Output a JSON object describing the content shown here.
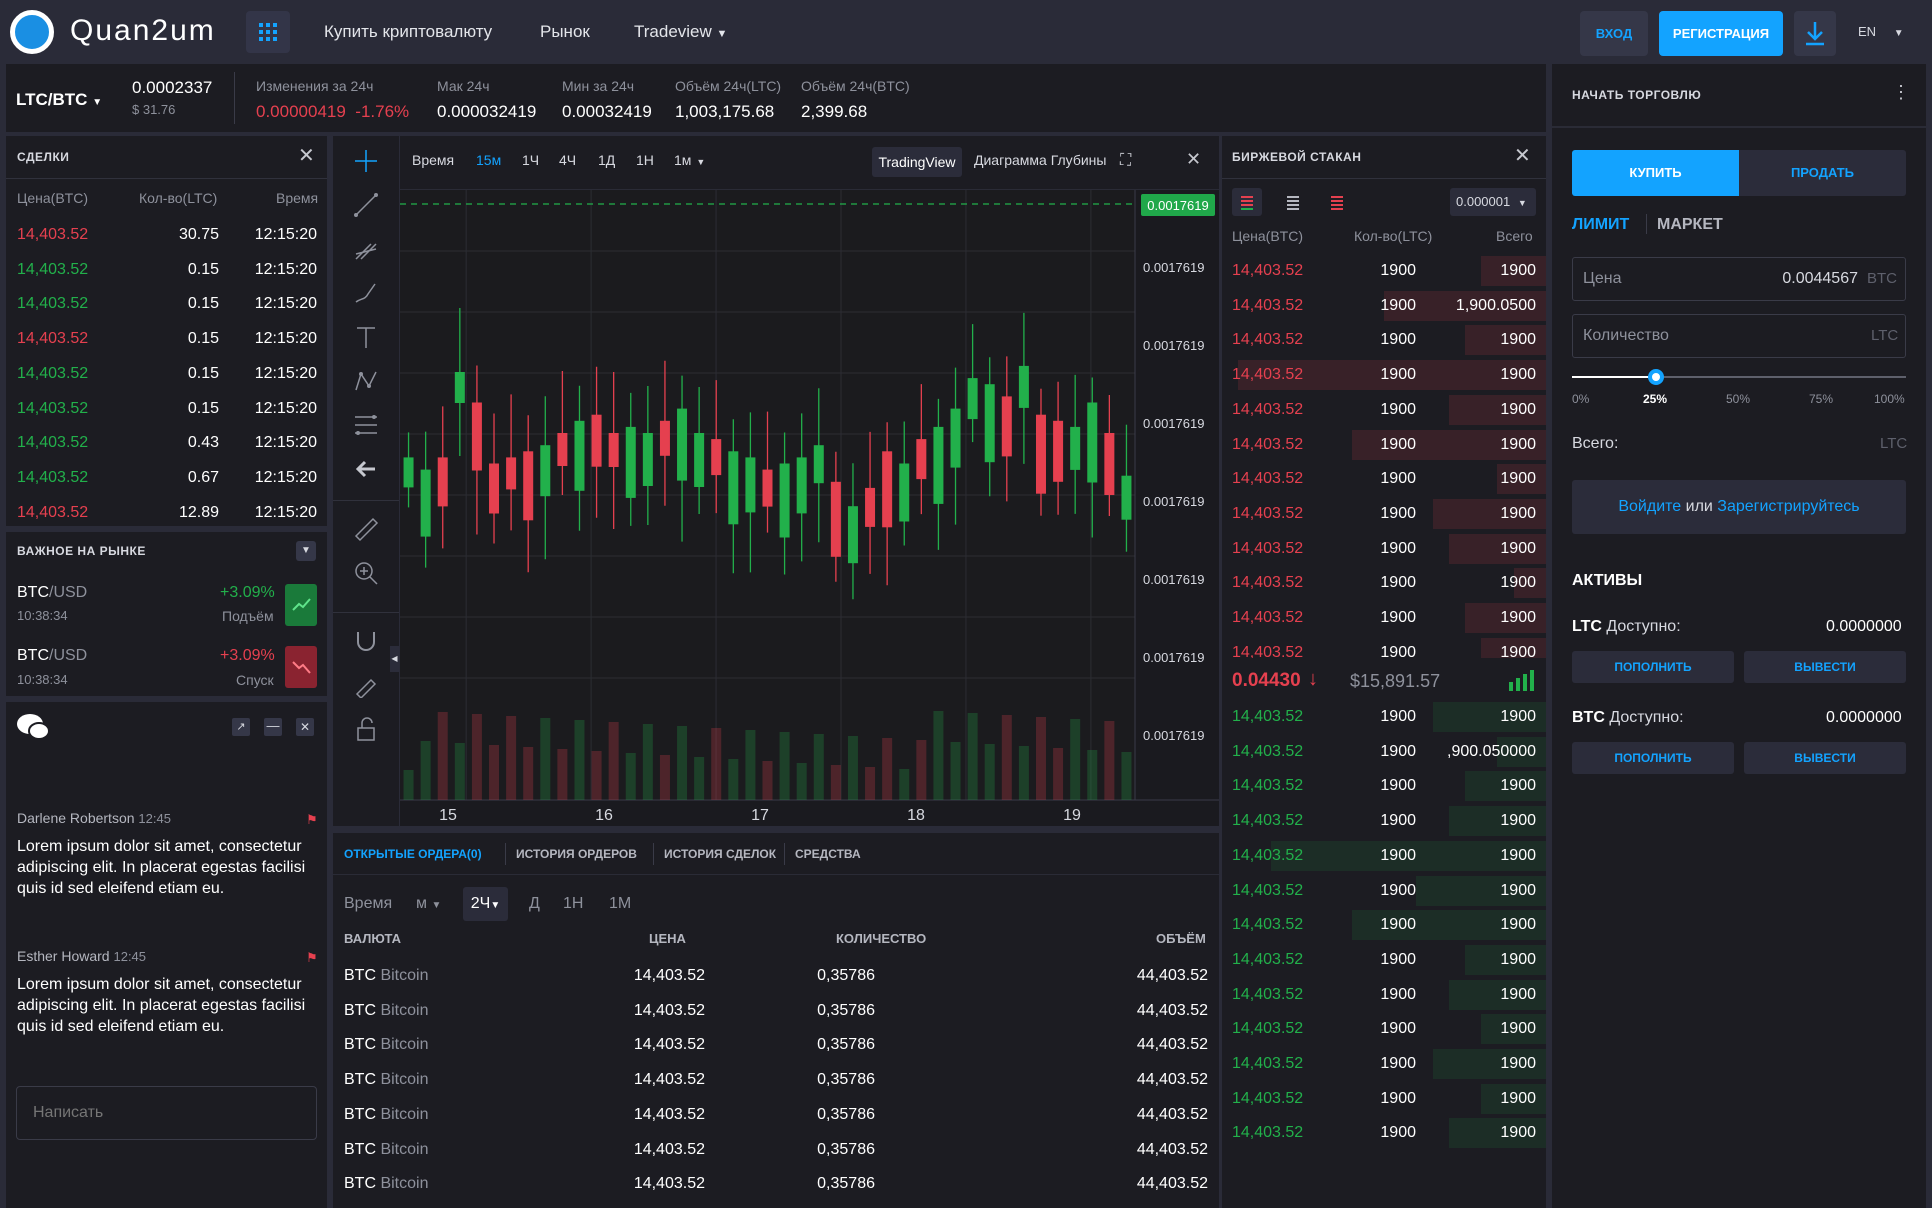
{
  "header": {
    "logo": "Quan2um",
    "nav": [
      "Купить криптовалюту",
      "Рынок",
      "Tradeview"
    ],
    "login": "ВХОД",
    "register": "РЕГИСТРАЦИЯ",
    "lang": "EN"
  },
  "pair": {
    "name": "LTC/BTC",
    "price": "0.0002337",
    "usd": "$ 31.76",
    "stats": [
      {
        "label": "Изменения за 24ч",
        "value": "0.00000419",
        "value2": "-1.76%"
      },
      {
        "label": "Мак 24ч",
        "value": "0.000032419"
      },
      {
        "label": "Мин за 24ч",
        "value": "0.00032419"
      },
      {
        "label": "Объём 24ч(LTC)",
        "value": "1,003,175.68"
      },
      {
        "label": "Объём 24ч(BTC)",
        "value": "2,399.68"
      }
    ]
  },
  "trades": {
    "title": "СДЕЛКИ",
    "cols": [
      "Цена(BTC)",
      "Кол-во(LTC)",
      "Время"
    ],
    "rows": [
      {
        "price": "14,403.52",
        "qty": "30.75",
        "time": "12:15:20",
        "side": "sell"
      },
      {
        "price": "14,403.52",
        "qty": "0.15",
        "time": "12:15:20",
        "side": "buy"
      },
      {
        "price": "14,403.52",
        "qty": "0.15",
        "time": "12:15:20",
        "side": "buy"
      },
      {
        "price": "14,403.52",
        "qty": "0.15",
        "time": "12:15:20",
        "side": "sell"
      },
      {
        "price": "14,403.52",
        "qty": "0.15",
        "time": "12:15:20",
        "side": "buy"
      },
      {
        "price": "14,403.52",
        "qty": "0.15",
        "time": "12:15:20",
        "side": "buy"
      },
      {
        "price": "14,403.52",
        "qty": "0.43",
        "time": "12:15:20",
        "side": "buy"
      },
      {
        "price": "14,403.52",
        "qty": "0.67",
        "time": "12:15:20",
        "side": "buy"
      },
      {
        "price": "14,403.52",
        "qty": "12.89",
        "time": "12:15:20",
        "side": "sell"
      }
    ]
  },
  "market": {
    "title": "ВАЖНОЕ НА РЫНКЕ",
    "items": [
      {
        "base": "BTC",
        "quote": "/USD",
        "time": "10:38:34",
        "change": "+3.09%",
        "label": "Подъём",
        "dir": "up"
      },
      {
        "base": "BTC",
        "quote": "/USD",
        "time": "10:38:34",
        "change": "+3.09%",
        "label": "Спуск",
        "dir": "down"
      }
    ]
  },
  "chat": {
    "messages": [
      {
        "user": "Darlene Robertson",
        "time": "12:45",
        "text": "Lorem ipsum dolor sit amet, consectetur adipiscing elit. In placerat egestas facilisi quis id sed eleifend etiam eu."
      },
      {
        "user": "Esther Howard",
        "time": "12:45",
        "text": "Lorem ipsum dolor sit amet, consectetur adipiscing elit. In placerat egestas facilisi quis id sed eleifend etiam eu."
      }
    ],
    "placeholder": "Написать"
  },
  "chart": {
    "timeframes": [
      "Время",
      "15м",
      "1Ч",
      "4Ч",
      "1Д",
      "1Н",
      "1м"
    ],
    "active_tf": "15м",
    "views": [
      "TradingView",
      "Диаграмма Глубины"
    ],
    "current_price": "0.0017619",
    "yticks": [
      "0.0017619",
      "0.0017619",
      "0.0017619",
      "0.0017619",
      "0.0017619",
      "0.0017619",
      "0.0017619",
      "0.0017619"
    ],
    "xticks": [
      "15",
      "16",
      "17",
      "18",
      "19"
    ]
  },
  "orders": {
    "tabs": [
      "ОТКРЫТЫЕ ОРДЕРА(0)",
      "ИСТОРИЯ ОРДЕРОВ",
      "ИСТОРИЯ СДЕЛОК",
      "СРЕДСТВА"
    ],
    "filters": [
      "Время",
      "м",
      "2Ч",
      "Д",
      "1Н",
      "1М"
    ],
    "cols": [
      "ВАЛЮТА",
      "ЦЕНА",
      "КОЛИЧЕСТВО",
      "ОБЪЁМ"
    ],
    "rows": [
      {
        "sym": "BTC",
        "name": "Bitcoin",
        "price": "14,403.52",
        "qty": "0,35786",
        "vol": "44,403.52"
      },
      {
        "sym": "BTC",
        "name": "Bitcoin",
        "price": "14,403.52",
        "qty": "0,35786",
        "vol": "44,403.52"
      },
      {
        "sym": "BTC",
        "name": "Bitcoin",
        "price": "14,403.52",
        "qty": "0,35786",
        "vol": "44,403.52"
      },
      {
        "sym": "BTC",
        "name": "Bitcoin",
        "price": "14,403.52",
        "qty": "0,35786",
        "vol": "44,403.52"
      },
      {
        "sym": "BTC",
        "name": "Bitcoin",
        "price": "14,403.52",
        "qty": "0,35786",
        "vol": "44,403.52"
      },
      {
        "sym": "BTC",
        "name": "Bitcoin",
        "price": "14,403.52",
        "qty": "0,35786",
        "vol": "44,403.52"
      },
      {
        "sym": "BTC",
        "name": "Bitcoin",
        "price": "14,403.52",
        "qty": "0,35786",
        "vol": "44,403.52"
      }
    ]
  },
  "orderbook": {
    "title": "БИРЖЕВОЙ СТАКАН",
    "precision": "0.000001",
    "cols": [
      "Цена(BTC)",
      "Кол-во(LTC)",
      "Всего"
    ],
    "asks": [
      {
        "price": "14,403.52",
        "qty": "1900",
        "total": "1900",
        "depth": 0.2
      },
      {
        "price": "14,403.52",
        "qty": "1900",
        "total": "1,900.0500",
        "depth": 0.5
      },
      {
        "price": "14,403.52",
        "qty": "1900",
        "total": "1900",
        "depth": 0.25
      },
      {
        "price": "14,403.52",
        "qty": "1900",
        "total": "1900",
        "depth": 0.95
      },
      {
        "price": "14,403.52",
        "qty": "1900",
        "total": "1900",
        "depth": 0.3
      },
      {
        "price": "14,403.52",
        "qty": "1900",
        "total": "1900",
        "depth": 0.6
      },
      {
        "price": "14,403.52",
        "qty": "1900",
        "total": "1900",
        "depth": 0.15
      },
      {
        "price": "14,403.52",
        "qty": "1900",
        "total": "1900",
        "depth": 0.35
      },
      {
        "price": "14,403.52",
        "qty": "1900",
        "total": "1900",
        "depth": 0.3
      },
      {
        "price": "14,403.52",
        "qty": "1900",
        "total": "1900",
        "depth": 0.1
      },
      {
        "price": "14,403.52",
        "qty": "1900",
        "total": "1900",
        "depth": 0.25
      },
      {
        "price": "14,403.52",
        "qty": "1900",
        "total": "1900",
        "depth": 0.2
      }
    ],
    "last": "0.04430",
    "last_usd": "$15,891.57",
    "bids": [
      {
        "price": "14,403.52",
        "qty": "1900",
        "total": "1900",
        "depth": 0.35
      },
      {
        "price": "14,403.52",
        "qty": "1900",
        "total": ",900.050000",
        "depth": 0.15
      },
      {
        "price": "14,403.52",
        "qty": "1900",
        "total": "1900",
        "depth": 0.25
      },
      {
        "price": "14,403.52",
        "qty": "1900",
        "total": "1900",
        "depth": 0.3
      },
      {
        "price": "14,403.52",
        "qty": "1900",
        "total": "1900",
        "depth": 0.85
      },
      {
        "price": "14,403.52",
        "qty": "1900",
        "total": "1900",
        "depth": 0.4
      },
      {
        "price": "14,403.52",
        "qty": "1900",
        "total": "1900",
        "depth": 0.6
      },
      {
        "price": "14,403.52",
        "qty": "1900",
        "total": "1900",
        "depth": 0.25
      },
      {
        "price": "14,403.52",
        "qty": "1900",
        "total": "1900",
        "depth": 0.3
      },
      {
        "price": "14,403.52",
        "qty": "1900",
        "total": "1900",
        "depth": 0.2
      },
      {
        "price": "14,403.52",
        "qty": "1900",
        "total": "1900",
        "depth": 0.35
      },
      {
        "price": "14,403.52",
        "qty": "1900",
        "total": "1900",
        "depth": 0.2
      },
      {
        "price": "14,403.52",
        "qty": "1900",
        "total": "1900",
        "depth": 0.3
      }
    ]
  },
  "trade": {
    "title": "НАЧАТЬ ТОРГОВЛЮ",
    "buy": "КУПИТЬ",
    "sell": "ПРОДАТЬ",
    "types": [
      "ЛИМИТ",
      "МАРКЕТ"
    ],
    "price_label": "Цена",
    "price_value": "0.0044567",
    "price_unit": "BTC",
    "qty_label": "Количество",
    "qty_unit": "LTC",
    "slider": [
      "0%",
      "25%",
      "50%",
      "75%",
      "100%"
    ],
    "slider_value": 0.25,
    "total_label": "Всего:",
    "total_unit": "LTC",
    "login": "Войдите",
    "or": "или",
    "register": "Зарегистрируйтесь"
  },
  "assets": {
    "title": "АКТИВЫ",
    "items": [
      {
        "sym": "LTC",
        "label": "Доступно:",
        "value": "0.0000000"
      },
      {
        "sym": "BTC",
        "label": "Доступно:",
        "value": "0.0000000"
      }
    ],
    "deposit": "ПОПОЛНИТЬ",
    "withdraw": "ВЫВЕСТИ"
  },
  "colors": {
    "accent": "#13a3ff",
    "up": "#22b04b",
    "down": "#e5404f",
    "panel": "#1c1c22",
    "bg": "#2a2b38"
  }
}
